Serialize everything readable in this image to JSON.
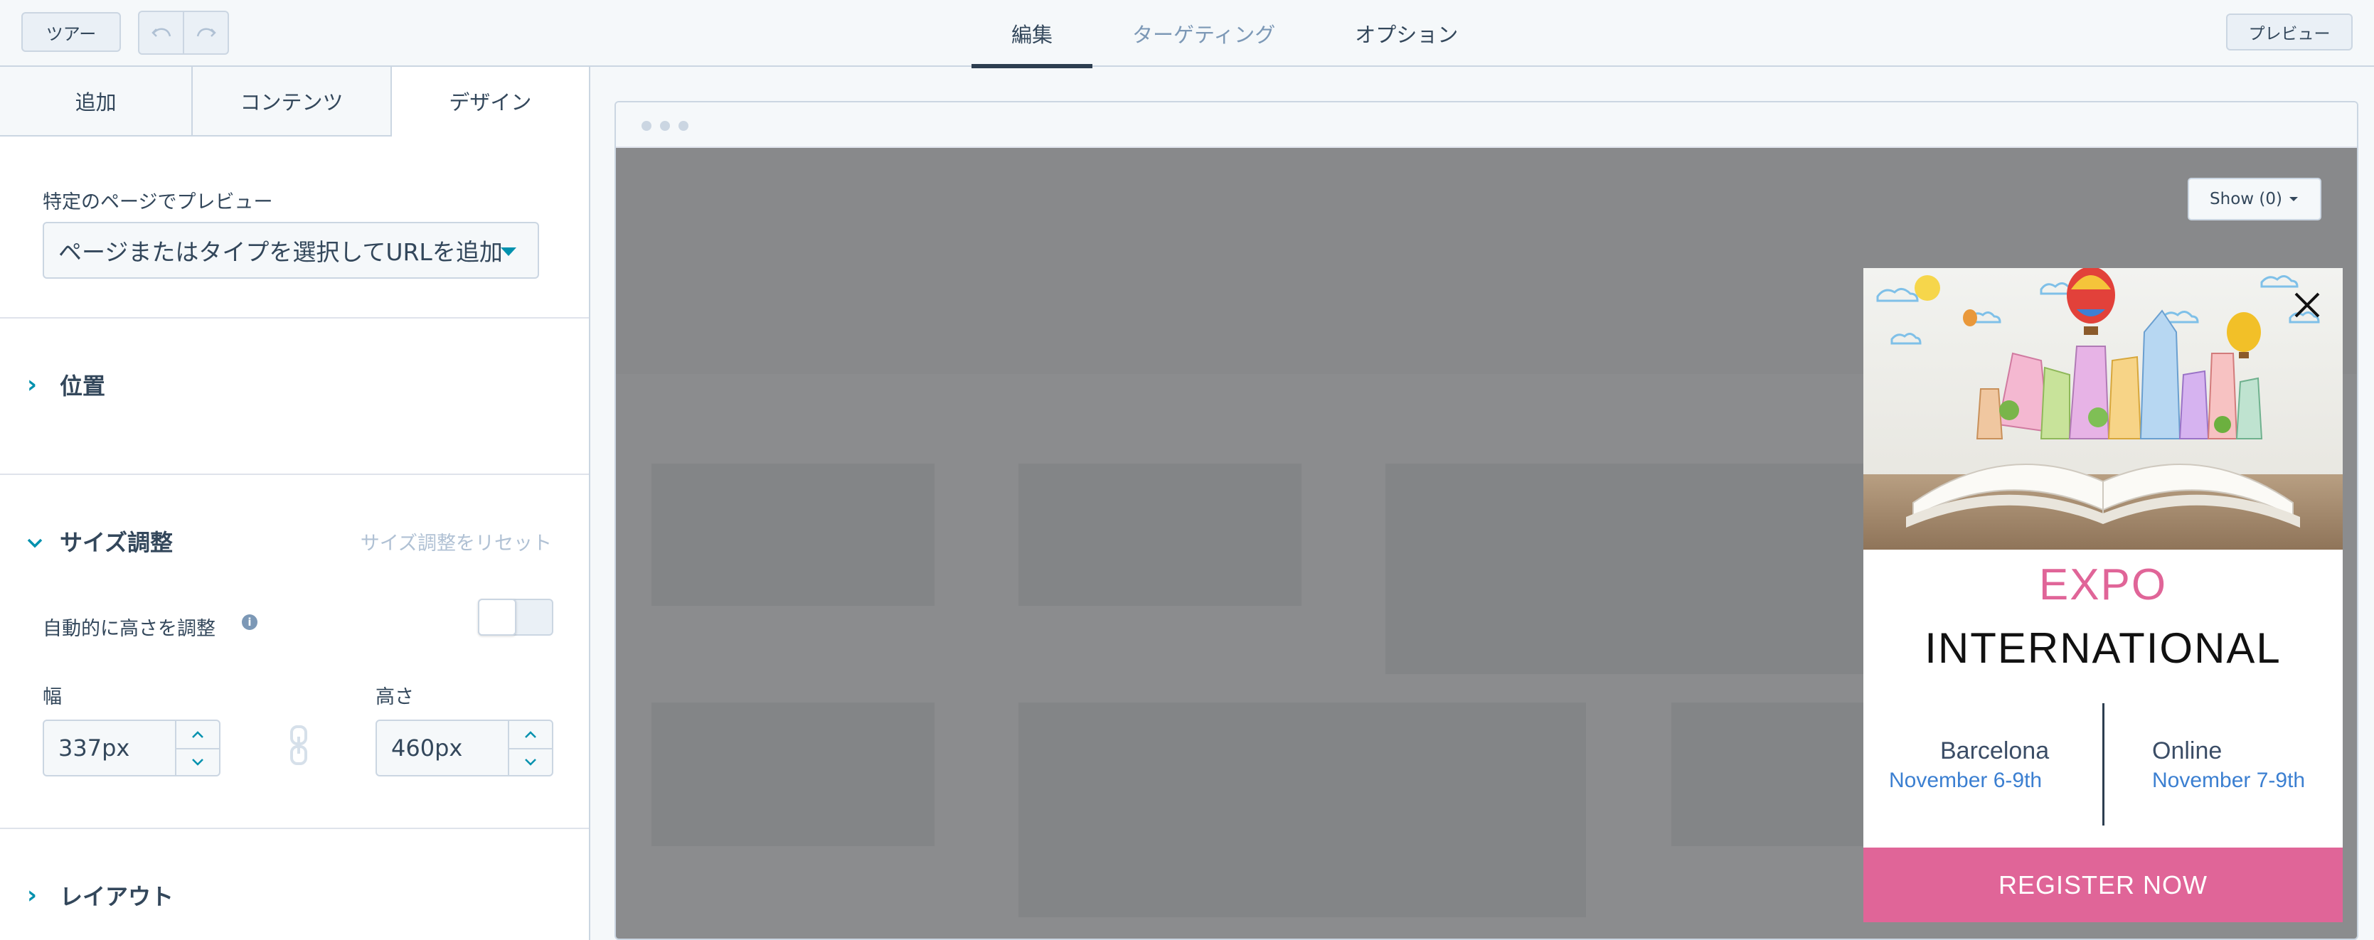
{
  "topbar": {
    "tour_label": "ツアー",
    "tabs": [
      {
        "label": "編集",
        "state": "active"
      },
      {
        "label": "ターゲティング",
        "state": "muted"
      },
      {
        "label": "オプション",
        "state": "normal"
      }
    ],
    "preview_label": "プレビュー"
  },
  "panel": {
    "tabs": [
      "追加",
      "コンテンツ",
      "デザイン"
    ],
    "preview_on_page_label": "特定のページでプレビュー",
    "preview_select_value": "ページまたはタイプを選択してURLを追加",
    "position_title": "位置",
    "sizing_title": "サイズ調整",
    "sizing_reset": "サイズ調整をリセット",
    "auto_height_label": "自動的に高さを調整",
    "width_label": "幅",
    "width_value": "337px",
    "height_label": "高さ",
    "height_value": "460px",
    "layout_title": "レイアウト"
  },
  "canvas": {
    "show_button": "Show (0)",
    "popup": {
      "title_line1": "EXPO",
      "title_line2": "INTERNATIONAL",
      "left_city": "Barcelona",
      "left_date": "November 6-9th",
      "right_city": "Online",
      "right_date": "November 7-9th",
      "cta": "REGISTER NOW"
    }
  },
  "colors": {
    "accent": "#0091ae",
    "popup_pink": "#e06598",
    "date_blue": "#3b7fd1"
  }
}
